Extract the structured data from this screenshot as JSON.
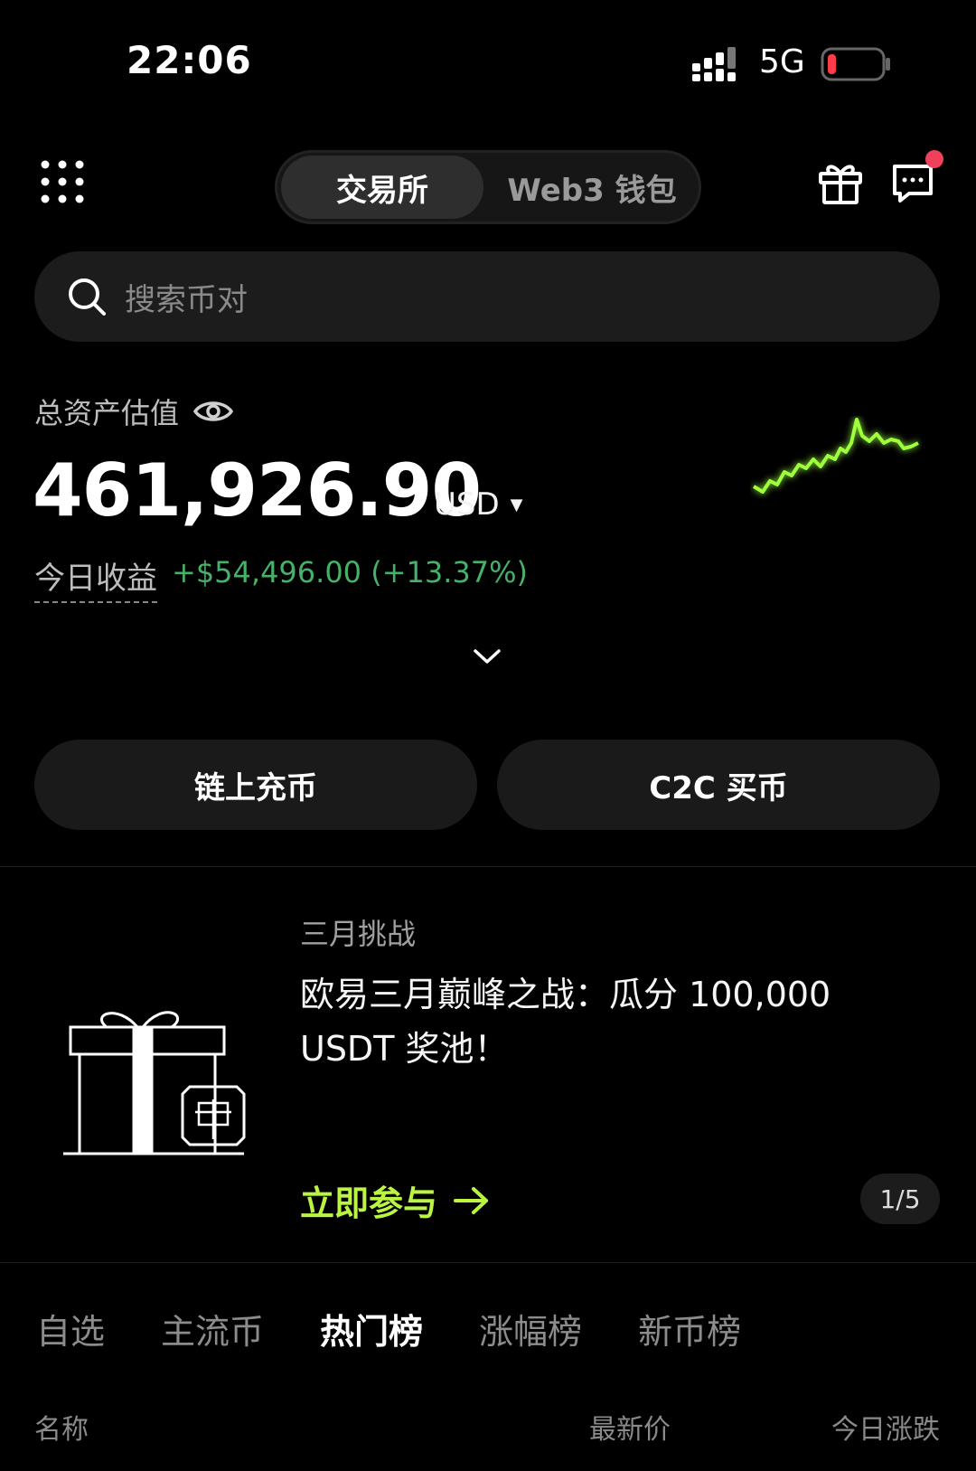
{
  "status_bar": {
    "time": "22:06",
    "network": "5G"
  },
  "header": {
    "segments": [
      "交易所",
      "Web3 钱包"
    ],
    "active_segment": "交易所"
  },
  "search": {
    "placeholder": "搜索币对"
  },
  "assets": {
    "label": "总资产估值",
    "value": "461,926.90",
    "unit": "USD",
    "pnl_label": "今日收益",
    "pnl_value": "+$54,496.00 (+13.37%)",
    "pnl_color": "#45b16a",
    "sparkline_color": "#9eff3c"
  },
  "actions": {
    "deposit": "链上充币",
    "c2c": "C2C 买币"
  },
  "banner": {
    "kicker": "三月挑战",
    "title": "欧易三月巅峰之战：瓜分 100,000 USDT 奖池！",
    "cta": "立即参与",
    "cta_color": "#b9f542",
    "pager": "1/5"
  },
  "market_tabs": [
    "自选",
    "主流币",
    "热门榜",
    "涨幅榜",
    "新币榜"
  ],
  "active_market_tab": "热门榜",
  "columns": {
    "name": "名称",
    "price": "最新价",
    "change": "今日涨跌"
  }
}
